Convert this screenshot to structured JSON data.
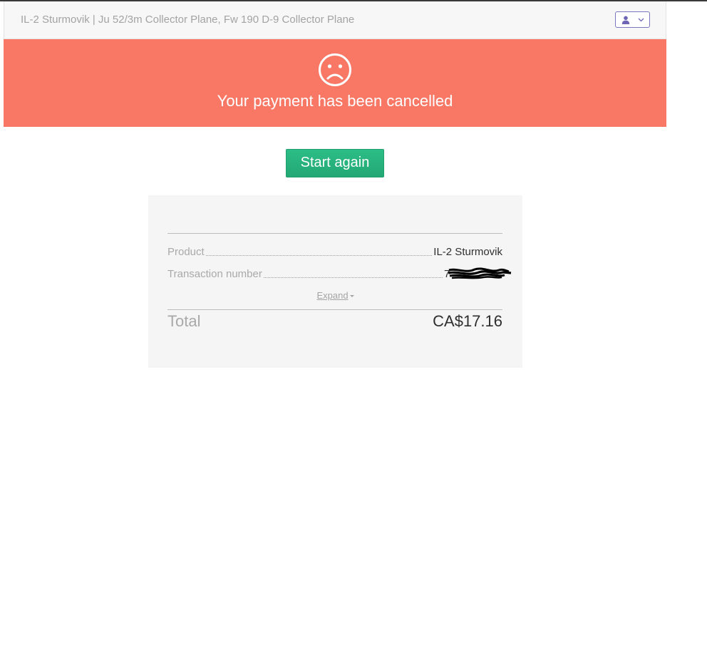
{
  "header": {
    "title": "IL-2 Sturmovik | Ju 52/3m Collector Plane, Fw 190 D-9 Collector Plane",
    "user_menu_icon": "user-icon",
    "user_menu_chevron": "chevron-down-icon"
  },
  "banner": {
    "icon": "sad-face-icon",
    "message": "Your payment has been cancelled",
    "color": "#f87765"
  },
  "actions": {
    "start_again_label": "Start again",
    "button_color": "#2dbd87"
  },
  "summary": {
    "rows": [
      {
        "label": "Product",
        "value": "IL-2 Sturmovik"
      },
      {
        "label": "Transaction number",
        "value": "7"
      }
    ],
    "expand_label": "Expand",
    "total_label": "Total",
    "total_value": "CA$17.16"
  }
}
